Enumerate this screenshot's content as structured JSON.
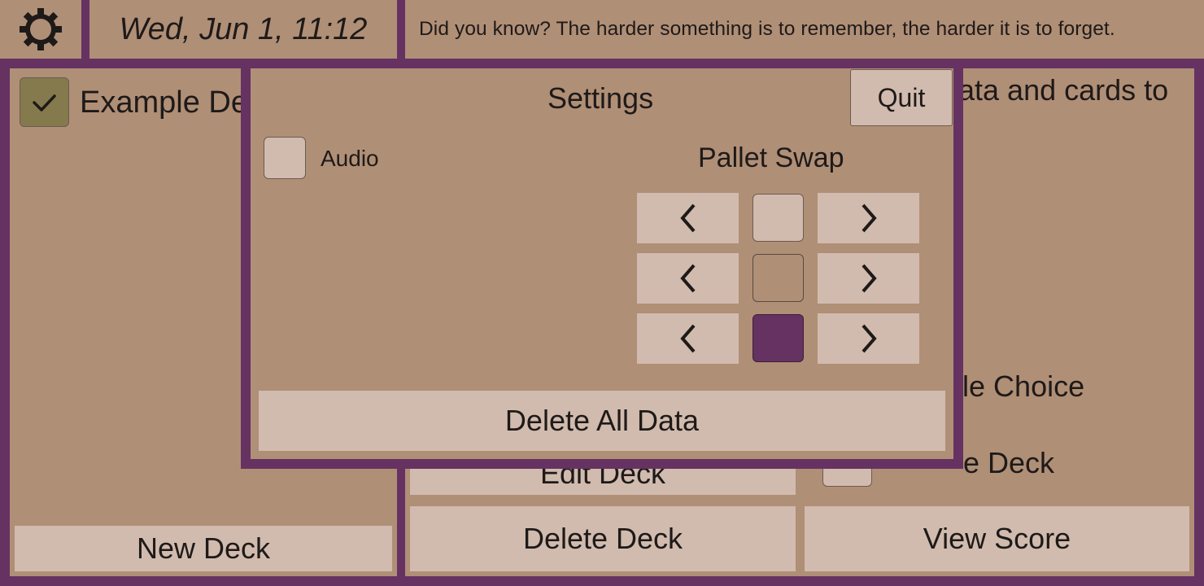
{
  "colors": {
    "frame": "#653262",
    "panel": "#b08f77",
    "button": "#d1bbae",
    "checked": "#847a4e",
    "swatch_light": "#d1bbae",
    "swatch_mid": "#b08f77",
    "swatch_dark": "#653262"
  },
  "topbar": {
    "settings_icon": "gear-icon",
    "datetime": "Wed, Jun 1, 11:12",
    "tip": "Did you know? The harder something is to remember, the harder it is to forget."
  },
  "decks": {
    "items": [
      {
        "label": "Example De",
        "checked": true
      }
    ],
    "new_deck_label": "New Deck"
  },
  "main": {
    "description_fragment": "ata and cards to",
    "multiple_choice_fragment": "ple Choice",
    "edit_deck_fragment": "Edit Deck",
    "shuffle_fragment": "e Deck",
    "delete_deck_label": "Delete Deck",
    "view_score_label": "View Score"
  },
  "settings": {
    "title": "Settings",
    "quit_label": "Quit",
    "audio_label": "Audio",
    "audio_checked": false,
    "pallet_title": "Pallet Swap",
    "prev_icon": "chevron-left-icon",
    "next_icon": "chevron-right-icon",
    "delete_all_label": "Delete All Data"
  }
}
